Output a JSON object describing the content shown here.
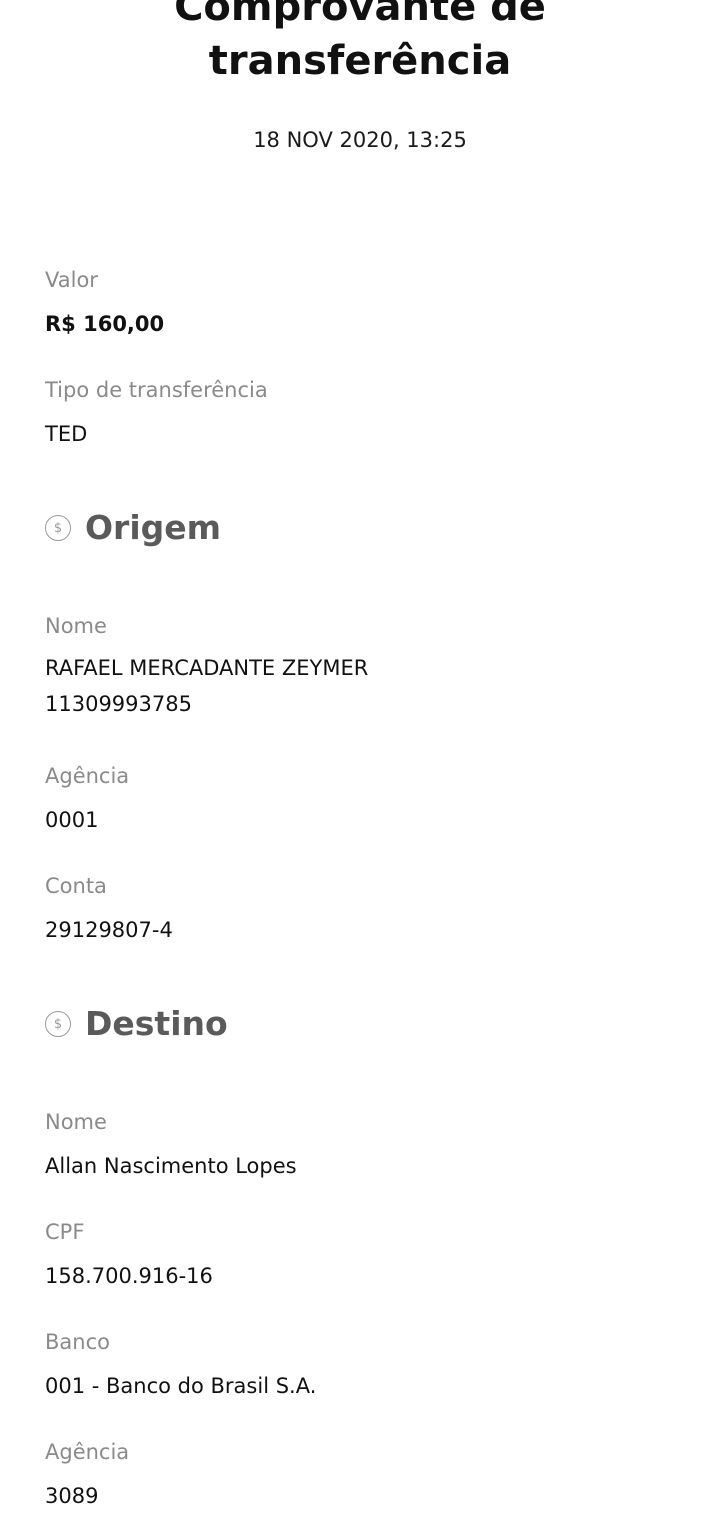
{
  "header": {
    "title": "Comprovante de\ntransferência",
    "datetime": "18 NOV 2020, 13:25"
  },
  "summary": {
    "valor_label": "Valor",
    "valor_value": "R$ 160,00",
    "tipo_label": "Tipo de transferência",
    "tipo_value": "TED"
  },
  "origem": {
    "section_title": "Origem",
    "icon": "dollar-coin-icon",
    "nome_label": "Nome",
    "nome_value": "RAFAEL MERCADANTE ZEYMER\n11309993785",
    "agencia_label": "Agência",
    "agencia_value": "0001",
    "conta_label": "Conta",
    "conta_value": "29129807-4"
  },
  "destino": {
    "section_title": "Destino",
    "icon": "dollar-coin-icon",
    "nome_label": "Nome",
    "nome_value": "Allan Nascimento Lopes",
    "cpf_label": "CPF",
    "cpf_value": "158.700.916-16",
    "banco_label": "Banco",
    "banco_value": "001 - Banco do Brasil S.A.",
    "agencia_label": "Agência",
    "agencia_value": "3089"
  },
  "colors": {
    "text": "#111111",
    "label": "#8a8a8a",
    "section": "#5a5a5a"
  }
}
